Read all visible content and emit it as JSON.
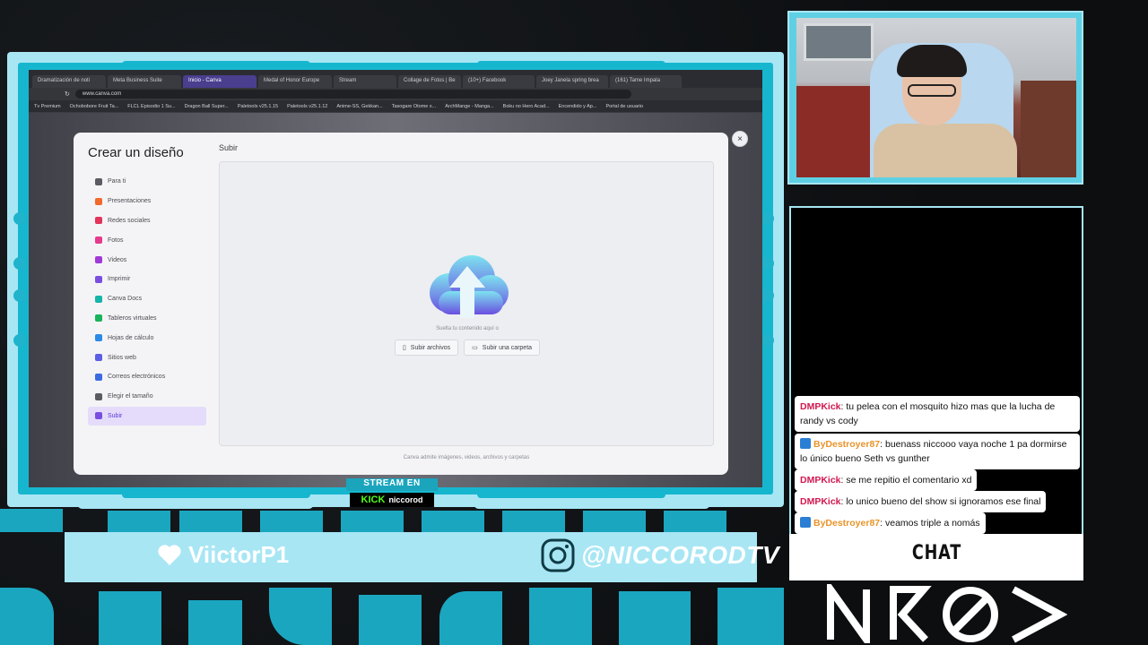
{
  "browser": {
    "tabs": [
      "Dramatización de noti",
      "Meta Business Suite",
      "Inicio - Canva",
      "Medal of Honor Europe",
      "Stream",
      "Collage de Fotos | Be",
      "(10+) Facebook",
      "Joey Janela spring brea",
      "(161) Tame Impala"
    ],
    "url": "www.canva.com",
    "bookmarks": [
      "Tv Premium",
      "Ochobobore Fruit Ta...",
      "FLCL Episodio 1 Su...",
      "Dragon Ball Super...",
      "Paletools v25.1.15",
      "Paletools v25.1.12",
      "Anime-SS, Gekkan...",
      "Tasogare Otome x...",
      "ArchMange - Manga...",
      "Boku no Hero Acad...",
      "Encendido y Ap...",
      "Portal de usuario"
    ]
  },
  "modal": {
    "title": "Crear un diseño",
    "section": "Subir",
    "close": "×",
    "sidebar": [
      {
        "label": "Para ti",
        "color": "#5b5c63"
      },
      {
        "label": "Presentaciones",
        "color": "#f06a2a"
      },
      {
        "label": "Redes sociales",
        "color": "#e3345b"
      },
      {
        "label": "Fotos",
        "color": "#e63a8d"
      },
      {
        "label": "Videos",
        "color": "#a03ad6"
      },
      {
        "label": "Imprimir",
        "color": "#7a4fe0"
      },
      {
        "label": "Canva Docs",
        "color": "#16b3a8"
      },
      {
        "label": "Tableros virtuales",
        "color": "#19b35c"
      },
      {
        "label": "Hojas de cálculo",
        "color": "#2b8ae6"
      },
      {
        "label": "Sitios web",
        "color": "#5a5fe6"
      },
      {
        "label": "Correos electrónicos",
        "color": "#3a6be0"
      },
      {
        "label": "Elegir el tamaño",
        "color": "#5b5c63"
      },
      {
        "label": "Subir",
        "color": "#7a4fe0"
      }
    ],
    "drop_text": "Suelta tu contenido aquí o",
    "upload_files": "Subir archivos",
    "upload_folder": "Subir una carpeta",
    "footnote": "Canva admite imágenes, videos, archivos y carpetas"
  },
  "stream": {
    "label": "STREAM EN",
    "platform": "KICK",
    "user": "niccorod"
  },
  "banner": {
    "follower": "ViictorP1",
    "instagram": "@NICCORODTV"
  },
  "chat": {
    "title": "CHAT",
    "messages": [
      {
        "user": "DMPKick",
        "text": ": tu pelea con el mosquito hizo mas que la lucha de randy vs cody",
        "badge": false
      },
      {
        "user": "ByDestroyer87",
        "text": ": buenass niccooo vaya noche 1 pa dormirse lo único bueno Seth vs gunther",
        "badge": true
      },
      {
        "user": "DMPKick",
        "text": ": se me repitio el comentario xd",
        "badge": false
      },
      {
        "user": "DMPKick",
        "text": ": lo unico bueno del show si ignoramos ese final",
        "badge": false
      },
      {
        "user": "ByDestroyer87",
        "text": ": veamos triple a nomás",
        "badge": true
      }
    ]
  },
  "colors": {
    "frame_light": "#a8e6f4",
    "frame_accent": "#17b6cf",
    "kick_green": "#53fc18",
    "chat_red_user": "#d2174f",
    "chat_orange_user": "#e8942a"
  }
}
